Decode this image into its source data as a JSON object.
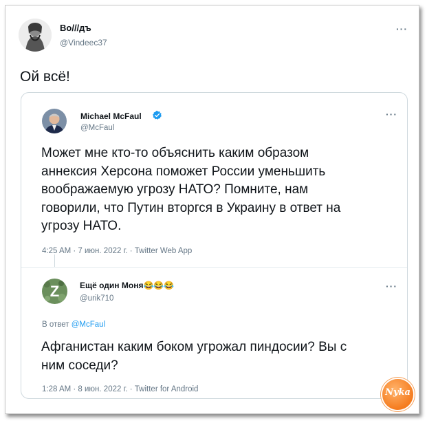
{
  "main_tweet": {
    "display_name": "Во///дъ",
    "handle": "@Vindeec37",
    "more": "···",
    "text": "Ой всё!"
  },
  "quoted_tweet": {
    "display_name": "Michael McFaul",
    "handle": "@McFaul",
    "more": "···",
    "text_lines": [
      "Может мне кто-то объяснить каким образом",
      "аннексия Херсона поможет России уменьшить",
      "воображаемую угрозу НАТО? Помните, нам",
      "говорили, что Путин вторгся в Украину в ответ на",
      "угрозу НАТО."
    ],
    "meta": "4:25 AM · 7 июн. 2022 г. · Twitter Web App",
    "colors": {
      "verified": "#1d9bf0"
    }
  },
  "reply_tweet": {
    "display_name": "Ещё один Моня😂😂😂",
    "handle": "@urik710",
    "more": "···",
    "avatar_letter": "Z",
    "replying_prefix": "В ответ",
    "replying_mention": "@McFaul",
    "text_lines": [
      "Афганистан каким боком угрожал пиндосии? Вы с",
      "ним соседи?"
    ],
    "meta": "1:28 AM · 8 июн. 2022 г. · Twitter for Android"
  },
  "watermark": {
    "text": "Nyka"
  }
}
